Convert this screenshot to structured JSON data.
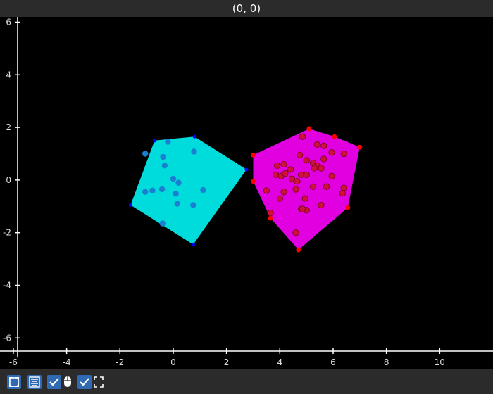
{
  "window": {
    "title": "(0, 0)"
  },
  "toolbar": {
    "buttons": [
      {
        "name": "autoscale-icon",
        "checked": false
      },
      {
        "name": "align-icon",
        "checked": false
      },
      {
        "name": "mouse-toggle-checkbox",
        "checked": true
      },
      {
        "name": "mouse-icon",
        "checked": false
      },
      {
        "name": "fullscreen-toggle-checkbox",
        "checked": true
      },
      {
        "name": "fullscreen-icon",
        "checked": false
      }
    ]
  },
  "colors": {
    "background": "#000000",
    "axes": "#ffffff",
    "hull_a": "#00dcdc",
    "hull_b": "#e000e0",
    "points_a": "#1a7fd0",
    "points_b": "#d0103a",
    "vertices_a": "#0000ff",
    "vertices_b": "#ff0000"
  },
  "chart_data": {
    "type": "scatter",
    "xlim": [
      -6.5,
      12
    ],
    "ylim": [
      -6.5,
      6.2
    ],
    "x_ticks": [
      -6,
      -4,
      -2,
      0,
      2,
      4,
      6,
      8,
      10
    ],
    "y_ticks": [
      -6,
      -4,
      -2,
      0,
      2,
      4,
      6
    ],
    "x_tick_labels": [
      "-6",
      "-4",
      "-2",
      "0",
      "2",
      "4",
      "6",
      "8",
      "10"
    ],
    "y_tick_labels": [
      "-6",
      "-4",
      "-2",
      "0",
      "2",
      "4",
      "6"
    ],
    "grid": false,
    "series": [
      {
        "hull": [
          [
            -1.6,
            -0.95
          ],
          [
            -0.7,
            1.5
          ],
          [
            0.8,
            1.65
          ],
          [
            2.75,
            0.4
          ],
          [
            0.75,
            -2.45
          ]
        ],
        "points": [
          [
            -1.05,
            1.0
          ],
          [
            -0.2,
            1.45
          ],
          [
            0.78,
            1.08
          ],
          [
            -0.38,
            0.88
          ],
          [
            -0.32,
            0.55
          ],
          [
            0.0,
            0.05
          ],
          [
            0.2,
            -0.1
          ],
          [
            -1.05,
            -0.45
          ],
          [
            -0.78,
            -0.4
          ],
          [
            -0.42,
            -0.35
          ],
          [
            0.1,
            -0.52
          ],
          [
            1.12,
            -0.38
          ],
          [
            0.15,
            -0.9
          ],
          [
            0.75,
            -0.95
          ],
          [
            -0.4,
            -1.65
          ]
        ]
      },
      {
        "hull": [
          [
            3.0,
            0.95
          ],
          [
            5.1,
            1.95
          ],
          [
            6.05,
            1.65
          ],
          [
            7.0,
            1.25
          ],
          [
            6.55,
            -1.05
          ],
          [
            4.7,
            -2.65
          ],
          [
            3.65,
            -1.45
          ],
          [
            3.0,
            -0.05
          ]
        ],
        "points": [
          [
            4.85,
            1.65
          ],
          [
            5.4,
            1.35
          ],
          [
            5.65,
            1.3
          ],
          [
            5.95,
            1.05
          ],
          [
            6.4,
            1.0
          ],
          [
            4.75,
            0.95
          ],
          [
            5.0,
            0.75
          ],
          [
            5.25,
            0.65
          ],
          [
            5.65,
            0.8
          ],
          [
            3.9,
            0.55
          ],
          [
            4.15,
            0.6
          ],
          [
            4.4,
            0.4
          ],
          [
            5.4,
            0.55
          ],
          [
            5.55,
            0.45
          ],
          [
            5.3,
            0.45
          ],
          [
            3.85,
            0.2
          ],
          [
            4.05,
            0.15
          ],
          [
            4.8,
            0.2
          ],
          [
            5.0,
            0.2
          ],
          [
            4.2,
            0.25
          ],
          [
            4.45,
            0.05
          ],
          [
            4.65,
            -0.05
          ],
          [
            5.95,
            0.15
          ],
          [
            5.25,
            -0.25
          ],
          [
            5.75,
            -0.25
          ],
          [
            4.6,
            -0.35
          ],
          [
            3.5,
            -0.4
          ],
          [
            4.15,
            -0.45
          ],
          [
            6.4,
            -0.3
          ],
          [
            6.35,
            -0.5
          ],
          [
            4.0,
            -0.7
          ],
          [
            4.95,
            -0.7
          ],
          [
            4.8,
            -1.1
          ],
          [
            5.0,
            -1.15
          ],
          [
            5.55,
            -0.95
          ],
          [
            3.65,
            -1.25
          ],
          [
            4.6,
            -2.0
          ],
          [
            4.85,
            -1.1
          ]
        ]
      }
    ]
  }
}
